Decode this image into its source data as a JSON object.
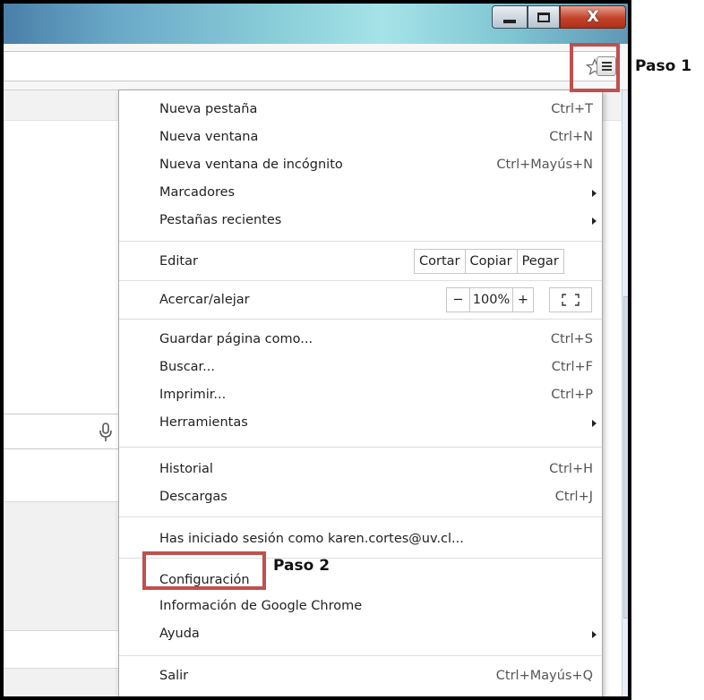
{
  "window": {
    "controls": {
      "minimize_icon": "minimize-icon",
      "maximize_icon": "maximize-icon",
      "close_glyph": "X"
    }
  },
  "toolbar": {
    "bookmark_icon": "star-icon",
    "menu_icon": "hamburger-menu-icon"
  },
  "page": {
    "search_mic_icon": "microphone-icon"
  },
  "menu": {
    "group1": [
      {
        "label": "Nueva pestaña",
        "shortcut": "Ctrl+T"
      },
      {
        "label": "Nueva ventana",
        "shortcut": "Ctrl+N"
      },
      {
        "label": "Nueva ventana de incógnito",
        "shortcut": "Ctrl+Mayús+N"
      },
      {
        "label": "Marcadores",
        "submenu": true
      },
      {
        "label": "Pestañas recientes",
        "submenu": true
      }
    ],
    "edit": {
      "label": "Editar",
      "cut": "Cortar",
      "copy": "Copiar",
      "paste": "Pegar"
    },
    "zoom": {
      "label": "Acercar/alejar",
      "minus": "−",
      "value": "100%",
      "plus": "+",
      "fullscreen_icon": "fullscreen-icon"
    },
    "group2": [
      {
        "label": "Guardar página como...",
        "shortcut": "Ctrl+S"
      },
      {
        "label": "Buscar...",
        "shortcut": "Ctrl+F"
      },
      {
        "label": "Imprimir...",
        "shortcut": "Ctrl+P"
      },
      {
        "label": "Herramientas",
        "submenu": true
      }
    ],
    "group3": [
      {
        "label": "Historial",
        "shortcut": "Ctrl+H"
      },
      {
        "label": "Descargas",
        "shortcut": "Ctrl+J"
      }
    ],
    "signed_in": "Has iniciado sesión como karen.cortes@uv.cl...",
    "group4": [
      {
        "label": "Configuración"
      },
      {
        "label": "Información de Google Chrome"
      },
      {
        "label": "Ayuda",
        "submenu": true
      }
    ],
    "exit": {
      "label": "Salir",
      "shortcut": "Ctrl+Mayús+Q"
    }
  },
  "annotations": {
    "step1": "Paso 1",
    "step2": "Paso 2",
    "color": "#c0504d"
  }
}
